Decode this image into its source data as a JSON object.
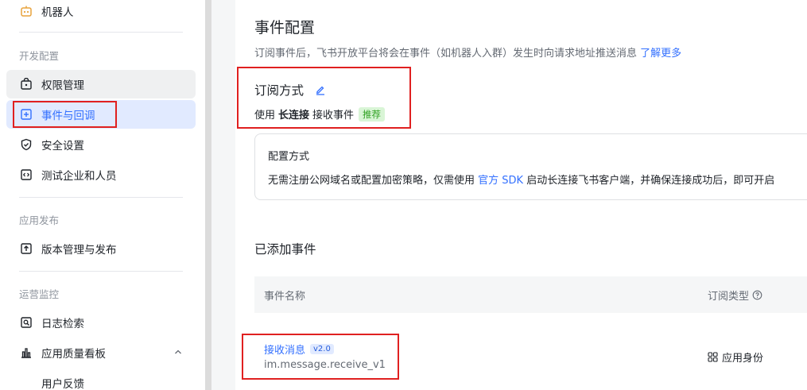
{
  "sidebar": {
    "top_item": {
      "label": "机器人",
      "icon": "robot-icon"
    },
    "sections": [
      {
        "label": "开发配置"
      },
      {
        "label": "应用发布"
      },
      {
        "label": "运营监控"
      }
    ],
    "items": [
      {
        "label": "权限管理",
        "icon": "permission-icon"
      },
      {
        "label": "事件与回调",
        "icon": "event-callback-icon"
      },
      {
        "label": "安全设置",
        "icon": "shield-icon"
      },
      {
        "label": "测试企业和人员",
        "icon": "code-icon"
      },
      {
        "label": "版本管理与发布",
        "icon": "upload-icon"
      },
      {
        "label": "日志检索",
        "icon": "log-search-icon"
      },
      {
        "label": "应用质量看板",
        "icon": "bar-chart-icon"
      },
      {
        "label": "用户反馈"
      }
    ]
  },
  "main": {
    "title": "事件配置",
    "description": "订阅事件后，飞书开放平台将会在事件（如机器人入群）发生时向请求地址推送消息",
    "learn_more": "了解更多",
    "subscription": {
      "title": "订阅方式",
      "prefix": "使用",
      "mode": "长连接",
      "suffix": "接收事件",
      "badge": "推荐"
    },
    "config_card": {
      "title": "配置方式",
      "text_before": "无需注册公网域名或配置加密策略，仅需使用",
      "sdk_link": "官方 SDK",
      "text_after": "启动长连接飞书客户端，并确保连接成功后，即可开启"
    },
    "added_events": {
      "title": "已添加事件",
      "columns": [
        "事件名称",
        "订阅类型"
      ],
      "rows": [
        {
          "name": "接收消息",
          "version": "v2.0",
          "code": "im.message.receive_v1",
          "identity": "应用身份"
        }
      ]
    }
  },
  "colors": {
    "accent": "#3370ff",
    "highlight": "#e02020",
    "active_bg": "#e1eaff"
  }
}
